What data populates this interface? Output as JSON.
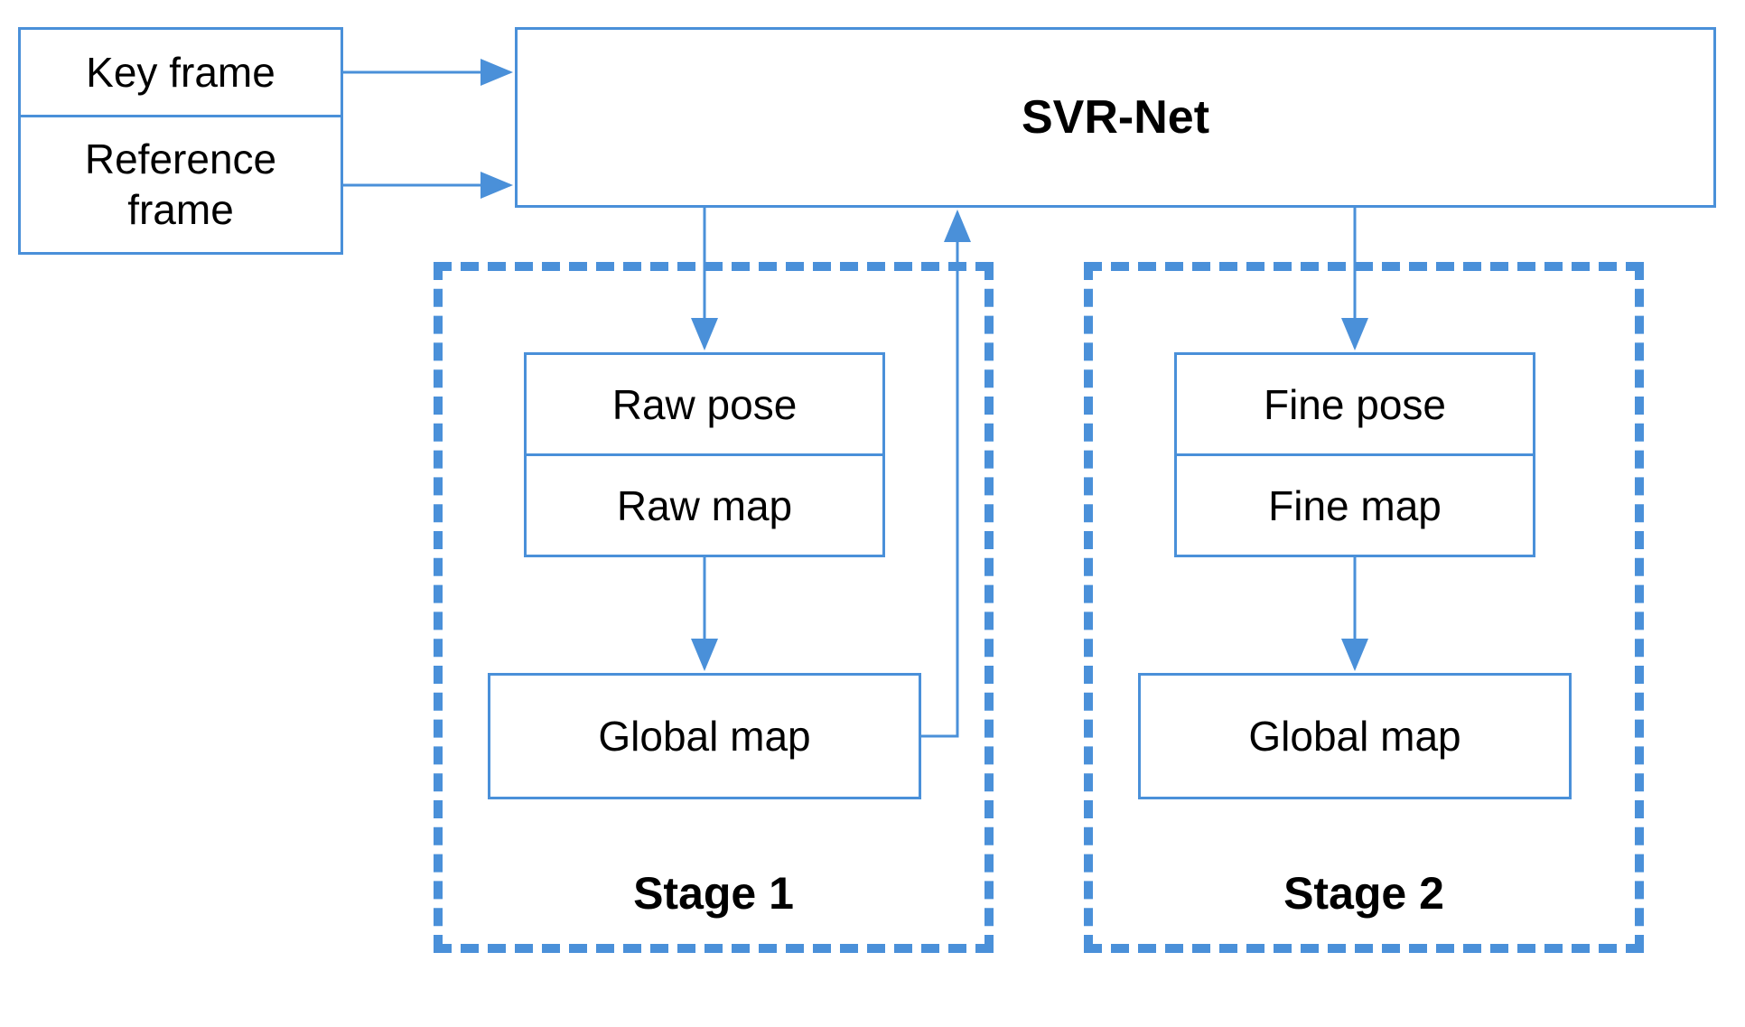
{
  "input": {
    "key_frame": "Key frame",
    "reference_frame": "Reference frame"
  },
  "network": {
    "title": "SVR-Net"
  },
  "stage1": {
    "label": "Stage 1",
    "raw_pose": "Raw pose",
    "raw_map": "Raw map",
    "global_map": "Global map"
  },
  "stage2": {
    "label": "Stage 2",
    "fine_pose": "Fine pose",
    "fine_map": "Fine map",
    "global_map": "Global map"
  },
  "colors": {
    "border": "#4a90d9",
    "text": "#000000",
    "background": "#ffffff"
  }
}
